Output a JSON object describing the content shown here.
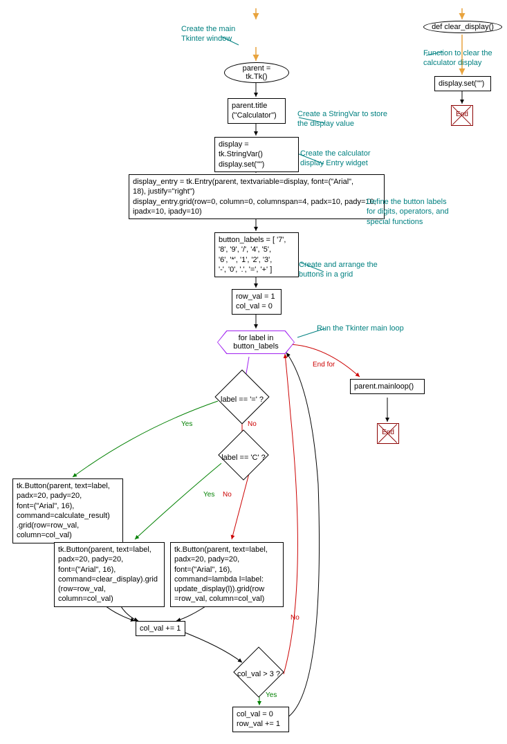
{
  "main": {
    "comment_main_window": "Create the main\nTkinter window",
    "parent_tk": "parent = tk.Tk()",
    "parent_title": "parent.title\n(\"Calculator\")",
    "comment_stringvar": "Create a StringVar to store\nthe display value",
    "display_set": "display = tk.StringVar()\ndisplay.set(\"\")",
    "comment_entry": "Create the calculator\ndisplay Entry widget",
    "display_entry": "display_entry = tk.Entry(parent, textvariable=display, font=(\"Arial\",\n18), justify=\"right\")\ndisplay_entry.grid(row=0, column=0, columnspan=4, padx=10, pady=10,\nipadx=10, ipady=10)",
    "comment_labels": "Define the button labels\nfor digits, operators, and\nspecial functions",
    "button_labels": "button_labels = [ '7',\n'8', '9', '/', '4', '5',\n'6', '*', '1', '2', '3',\n'-', '0', '.', '=', '+' ]",
    "comment_arrange": "Create and arrange the\nbuttons in a grid",
    "row_col_init": "row_val = 1\ncol_val = 0",
    "for_loop": "for label in\nbutton_labels",
    "comment_mainloop": "Run the Tkinter main loop",
    "label_eq": "label == '=' ?",
    "label_c": "label == 'C' ?",
    "btn_calc": "tk.Button(parent, text=label,\npadx=20, pady=20,\nfont=(\"Arial\", 16),\ncommand=calculate_result)\n.grid(row=row_val,\ncolumn=col_val)",
    "btn_clear": "tk.Button(parent, text=label,\npadx=20, pady=20,\nfont=(\"Arial\", 16),\ncommand=clear_display).grid\n(row=row_val,\ncolumn=col_val)",
    "btn_update": "tk.Button(parent, text=label,\npadx=20, pady=20,\nfont=(\"Arial\", 16),\ncommand=lambda l=label:\nupdate_display(l)).grid(row\n=row_val, column=col_val)",
    "col_inc": "col_val += 1",
    "col_gt3": "col_val > 3 ?",
    "reset_col": "col_val = 0\nrow_val += 1",
    "mainloop": "parent.mainloop()",
    "end": "End",
    "endfor_label": "End for",
    "yes": "Yes",
    "no": "No"
  },
  "side": {
    "def_clear": "def clear_display()",
    "comment_clear": "Function to clear the\ncalculator display",
    "display_set": "display.set(\"\")",
    "end": "End"
  }
}
